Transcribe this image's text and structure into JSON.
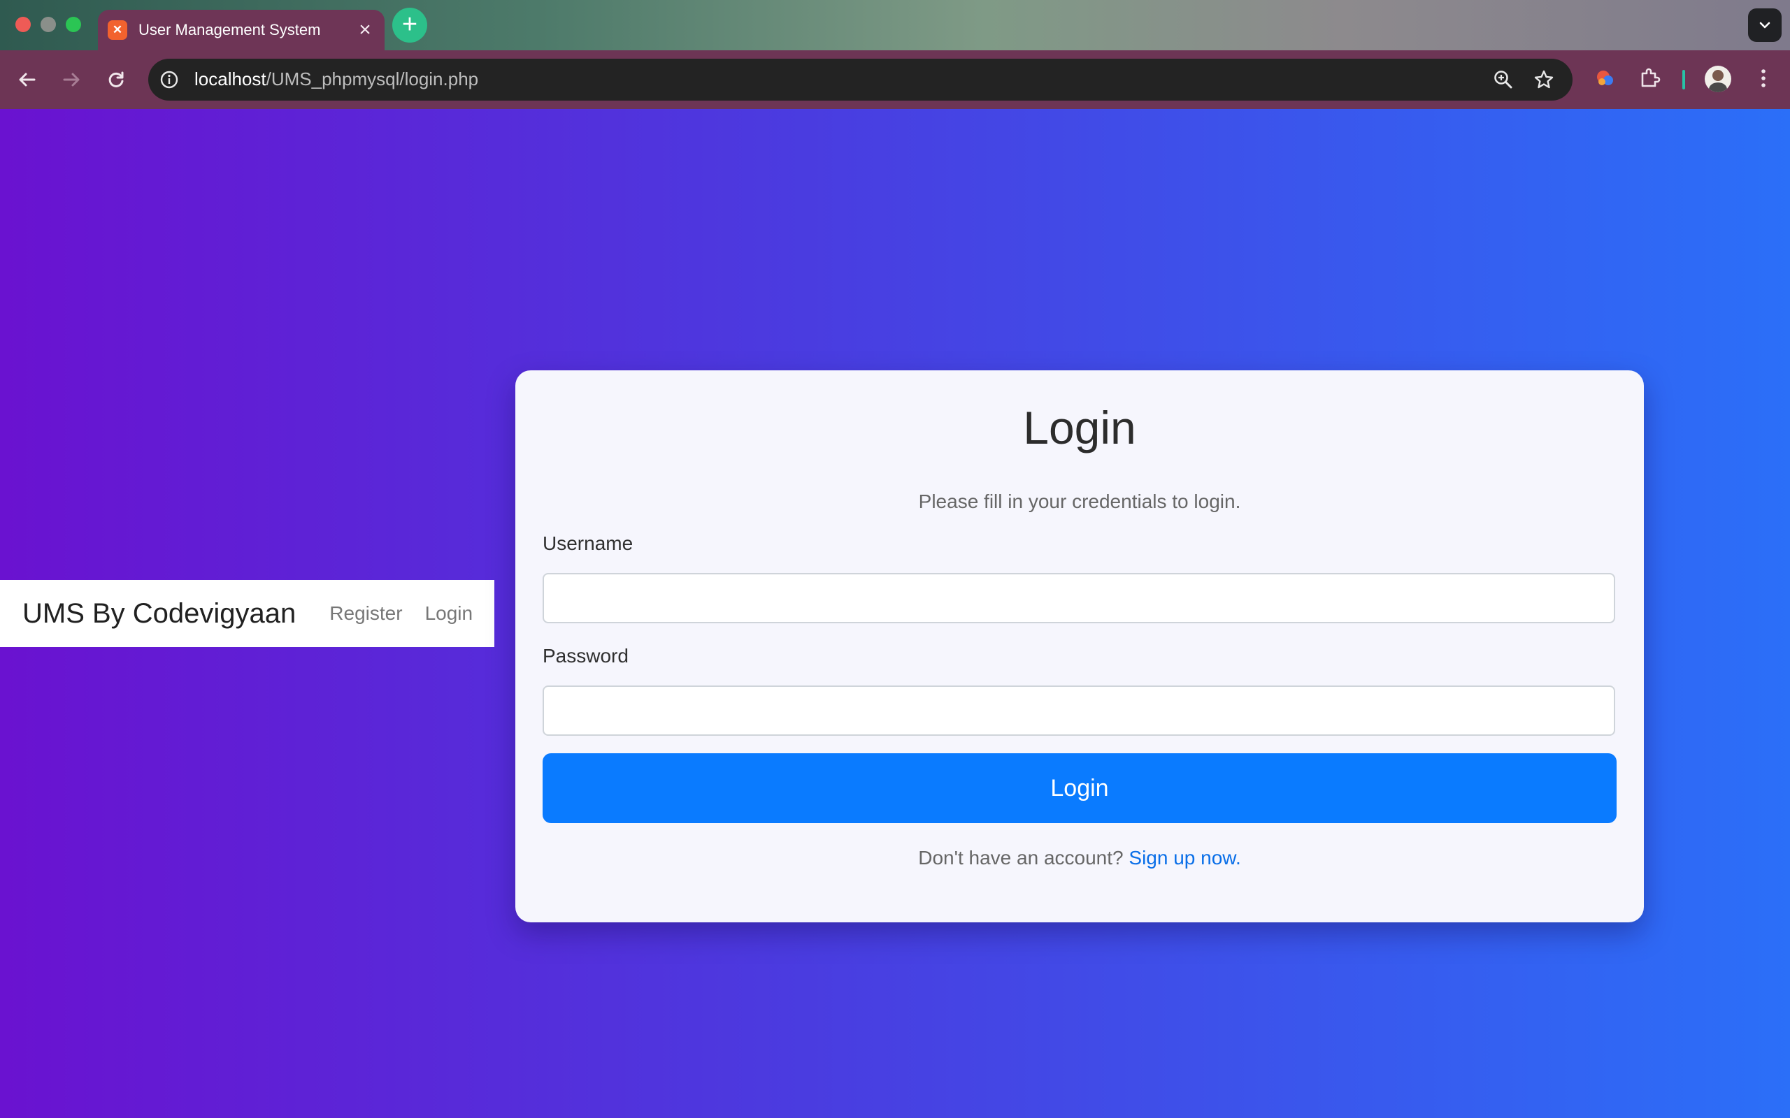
{
  "browser": {
    "tab_title": "User Management System",
    "tab_close": "×",
    "new_tab": "+",
    "url_host": "localhost",
    "url_path": "/UMS_phpmysql/login.php"
  },
  "navbar": {
    "brand": "UMS By Codevigyaan",
    "links": [
      "Register",
      "Login"
    ]
  },
  "login_card": {
    "title": "Login",
    "subtitle": "Please fill in your credentials to login.",
    "username_label": "Username",
    "username_value": "",
    "password_label": "Password",
    "password_value": "",
    "submit_label": "Login",
    "signup_prompt": "Don't have an account?",
    "signup_link": "Sign up now."
  },
  "colors": {
    "primary_button": "#0a7bff",
    "link": "#0a6fe8",
    "gradient_start": "#6a12d0",
    "gradient_end": "#2b6ff8"
  },
  "icons": {
    "tab_favicon": "xampp-icon",
    "back": "arrow-left-icon",
    "forward": "arrow-right-icon",
    "reload": "reload-icon",
    "site_info": "info-icon",
    "zoom": "zoom-icon",
    "bookmark": "star-icon",
    "extensions": "puzzle-icon",
    "profile": "avatar",
    "menu": "kebab-menu-icon"
  }
}
